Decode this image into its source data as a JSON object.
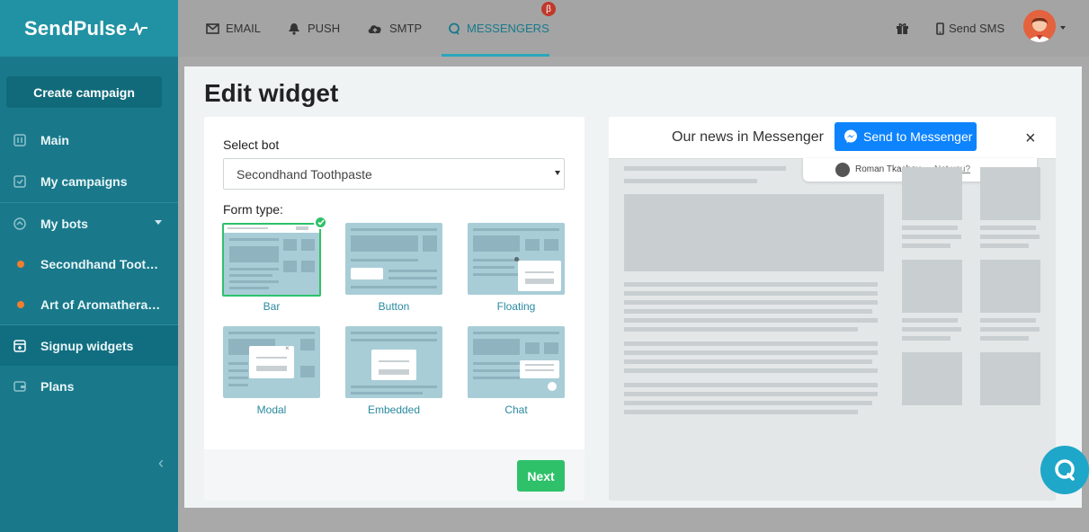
{
  "app": {
    "logo_text": "SendPulse"
  },
  "sidebar": {
    "create_label": "Create campaign",
    "items": [
      {
        "label": "Main",
        "icon": "dashboard-icon"
      },
      {
        "label": "My campaigns",
        "icon": "campaign-icon"
      },
      {
        "label": "My bots",
        "icon": "bots-icon"
      },
      {
        "label": "Secondhand Toot…",
        "icon": "dot-icon"
      },
      {
        "label": "Art of Aromathera…",
        "icon": "dot-icon"
      },
      {
        "label": "Signup widgets",
        "icon": "widget-icon"
      },
      {
        "label": "Plans",
        "icon": "wallet-icon"
      }
    ]
  },
  "topnav": {
    "tabs": [
      {
        "label": "EMAIL",
        "icon": "envelope-icon"
      },
      {
        "label": "PUSH",
        "icon": "bell-icon"
      },
      {
        "label": "SMTP",
        "icon": "cloud-upload-icon"
      },
      {
        "label": "MESSENGERS",
        "icon": "chat-icon"
      }
    ],
    "beta_badge": "β",
    "send_sms": "Send SMS"
  },
  "page": {
    "title": "Edit widget"
  },
  "form": {
    "select_bot_label": "Select bot",
    "select_bot_value": "Secondhand Toothpaste",
    "form_type_label": "Form type:",
    "types": [
      "Bar",
      "Button",
      "Floating",
      "Modal",
      "Embedded",
      "Chat"
    ],
    "selected_type": "Bar",
    "next_label": "Next"
  },
  "preview": {
    "bar_text": "Our news in Messenger",
    "messenger_button": "Send to Messenger",
    "close": "×",
    "user_name": "Roman Tkachev",
    "not_you": "Not you?"
  },
  "colors": {
    "sidebar": "#19798b",
    "accent": "#2aa7bd",
    "primary_green": "#2ec16a",
    "messenger_blue": "#0d84fe",
    "bullet_orange": "#f07e2e"
  }
}
